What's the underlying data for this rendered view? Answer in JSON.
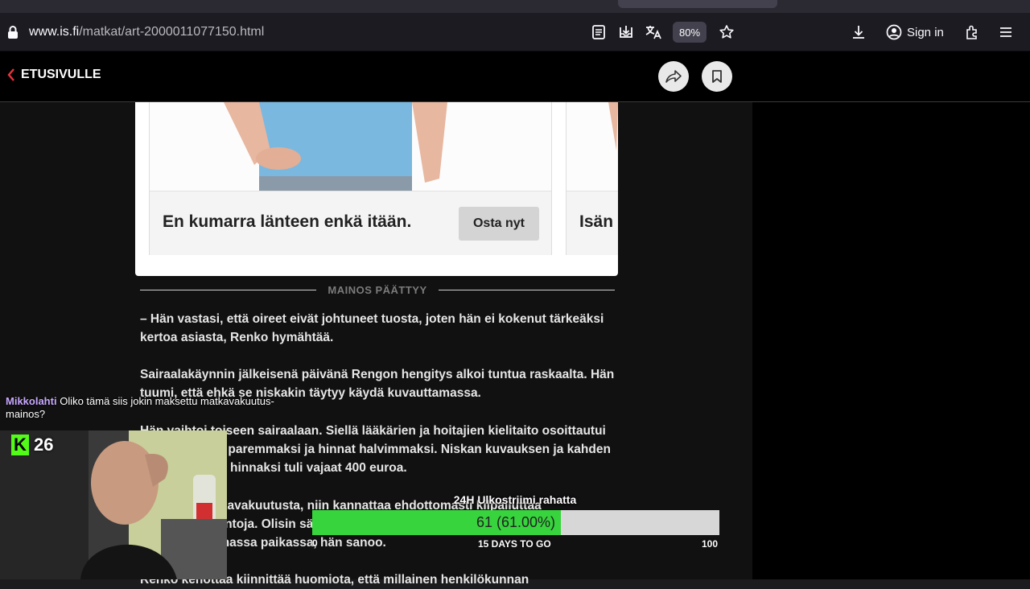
{
  "browser": {
    "url_host": "www.is.fi",
    "url_path": "/matkat/art-2000011077150.html",
    "zoom": "80%",
    "sign_in": "Sign in"
  },
  "site": {
    "back_label": "ETUSIVULLE"
  },
  "ad": {
    "card1_text": "En kumarra länteen enkä itään.",
    "card1_button": "Osta nyt",
    "card2_text": "Isän",
    "end_label": "MAINOS PÄÄTTYY"
  },
  "article": {
    "paragraphs": [
      "– Hän vastasi, että oireet eivät johtuneet tuosta, joten hän ei kokenut tärkeäksi kertoa asiasta, Renko hymähtää.",
      "Sairaalakäynnin jälkeisenä päivänä Rengon hengitys alkoi tuntua raskaalta. Hän tuumi, että ehkä se niskakin täytyy käydä kuvauttamassa.",
      "Hän vaihtoi toiseen sairaalaan. Siellä lääkärien ja hoitajien kielitaito osoittautui huomattavasti paremmaksi ja hinnat halvimmaksi. Niskan kuvauksen ja kahden lääkärikäynnin hinnaksi tuli vajaat 400 euroa.",
      "Jos ottaa matkavakuutusta, niin kannattaa ehdottomasti kilpailuttaa vakuutusyhtiöntoja. Olisin säästänyt paljon, jos olisin mennyt suoraan euroilla tässä halvemmassa paikassa, hän sanoo.",
      "Renko kehottaa kiinnittää huomiota, että millainen henkilökunnan"
    ]
  },
  "stream": {
    "chat_user": "Mikkolahti",
    "chat_message": "Oliko tämä siis jokin maksettu matkavakuutus-mainos?",
    "viewer_logo": "K",
    "viewer_count": "26",
    "goal_title": "24H Ulkostriimi rahatta",
    "goal_value_text": "61 (61.00%)",
    "goal_progress": 0.61,
    "goal_min": "0",
    "goal_days": "15 DAYS TO GO",
    "goal_max": "100"
  }
}
